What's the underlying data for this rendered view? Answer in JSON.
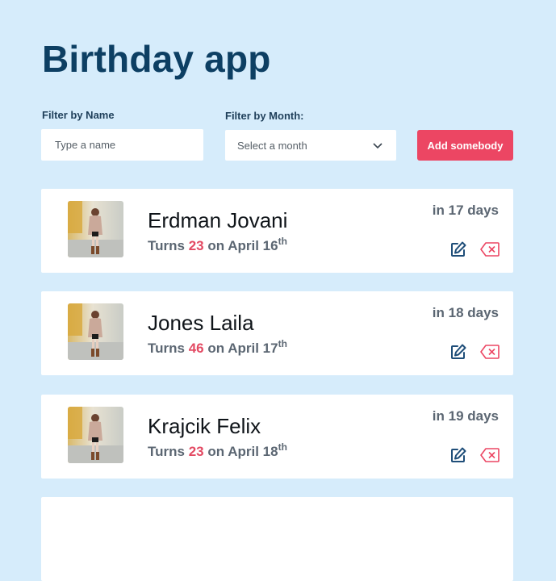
{
  "app": {
    "title": "Birthday app"
  },
  "filters": {
    "name_label": "Filter by Name",
    "name_placeholder": "Type a name",
    "month_label": "Filter by Month:",
    "month_selected": "Select a month",
    "add_button": "Add somebody"
  },
  "people": [
    {
      "name": "Erdman Jovani",
      "turns_prefix": "Turns",
      "age": "23",
      "date_text": "on April 16",
      "suffix": "th",
      "countdown": "in 17 days"
    },
    {
      "name": "Jones Laila",
      "turns_prefix": "Turns",
      "age": "46",
      "date_text": "on April 17",
      "suffix": "th",
      "countdown": "in 18 days"
    },
    {
      "name": "Krajcik Felix",
      "turns_prefix": "Turns",
      "age": "23",
      "date_text": "on April 18",
      "suffix": "th",
      "countdown": "in 19 days"
    }
  ],
  "icons": {
    "edit": "edit-icon",
    "delete": "backspace-delete-icon",
    "dropdown": "chevron-down-icon"
  },
  "colors": {
    "accent": "#ec4663",
    "title": "#0d3f63",
    "icon": "#1f4e79"
  }
}
